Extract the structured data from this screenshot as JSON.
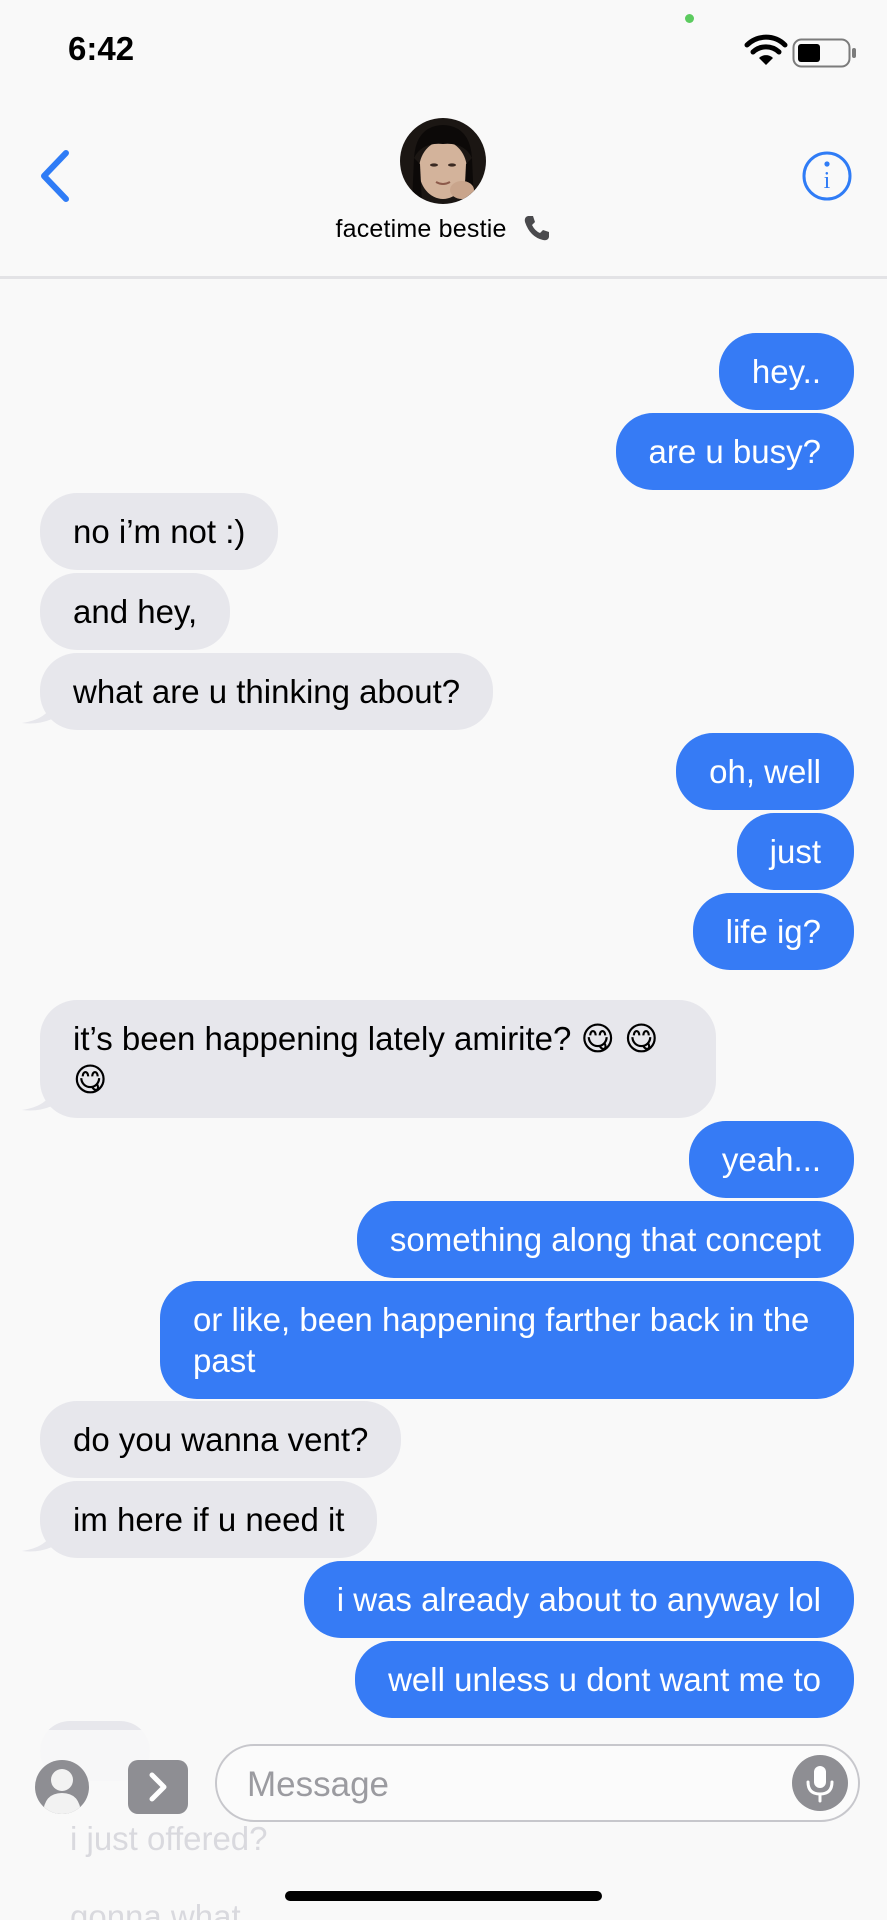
{
  "status_bar": {
    "time": "6:42"
  },
  "header": {
    "contact_name": "facetime bestie",
    "contact_emoji": "📞",
    "back_icon": "chevron-left-icon",
    "info_icon": "info-icon"
  },
  "messages": [
    {
      "from": "me",
      "text": "hey.."
    },
    {
      "from": "me",
      "text": "are u busy?"
    },
    {
      "from": "them",
      "text": "no i’m not :)"
    },
    {
      "from": "them",
      "text": "and hey,"
    },
    {
      "from": "them",
      "text": "what are u thinking about?"
    },
    {
      "from": "me",
      "text": "oh, well"
    },
    {
      "from": "me",
      "text": "just"
    },
    {
      "from": "me",
      "text": "life ig?"
    },
    {
      "from": "them",
      "text": "it’s been happening lately amirite? 😋 😋 😋"
    },
    {
      "from": "me",
      "text": "yeah..."
    },
    {
      "from": "me",
      "text": "something along that concept"
    },
    {
      "from": "me",
      "text": "or like, been happening farther back in the past"
    },
    {
      "from": "them",
      "text": "do you wanna vent?"
    },
    {
      "from": "them",
      "text": "im here if u need it"
    },
    {
      "from": "me",
      "text": "i was already about to anyway lol"
    },
    {
      "from": "me",
      "text": "well unless u dont want me to"
    }
  ],
  "behind_compose": {
    "line1": "i just offered?",
    "line2": "gonna what"
  },
  "compose": {
    "placeholder": "Message"
  },
  "colors": {
    "outgoing_bubble": "#367bf5",
    "incoming_bubble": "#e7e7ec",
    "accent": "#2f7cf6"
  }
}
